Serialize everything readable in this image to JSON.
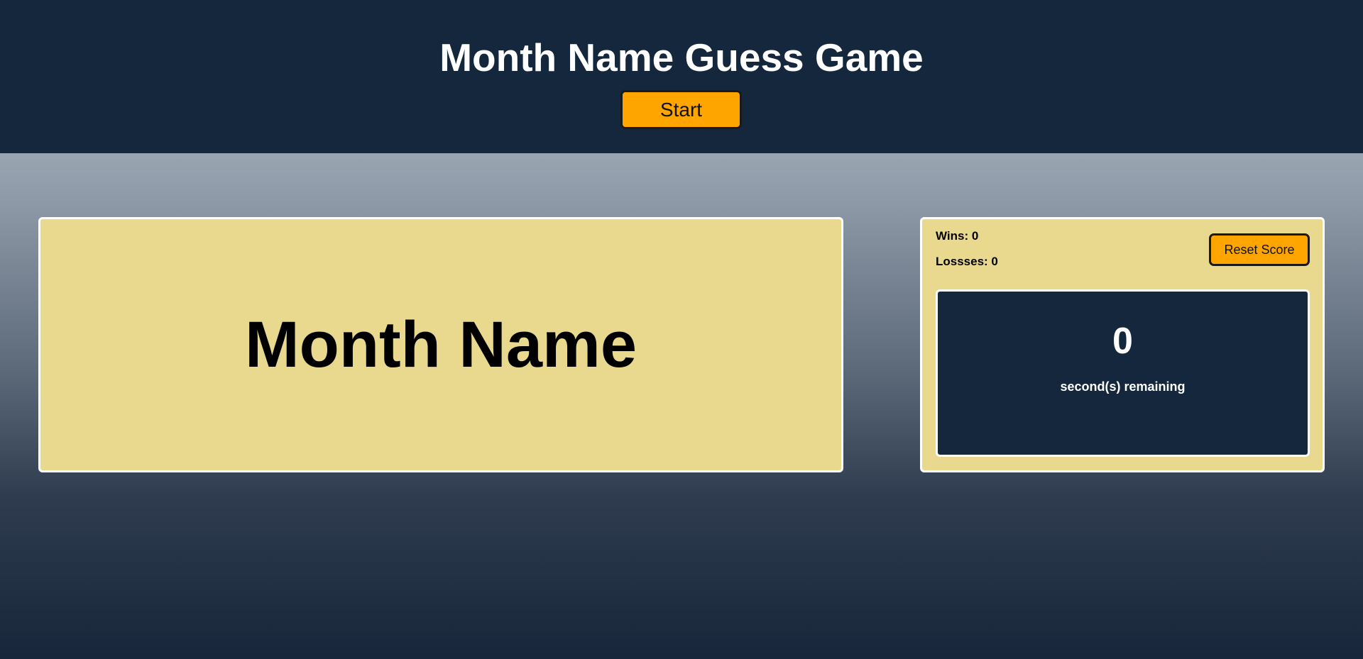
{
  "header": {
    "title": "Month Name Guess Game",
    "start_label": "Start"
  },
  "game": {
    "month_name": "Month Name"
  },
  "score": {
    "wins_label": "Wins: 0",
    "losses_label": "Lossses: 0",
    "reset_label": "Reset Score",
    "timer_value": "0",
    "timer_label": "second(s) remaining"
  },
  "colors": {
    "header_bg": "#14273d",
    "panel_bg": "#e8d98e",
    "button_bg": "#ffa500",
    "timer_bg": "#14273d"
  }
}
